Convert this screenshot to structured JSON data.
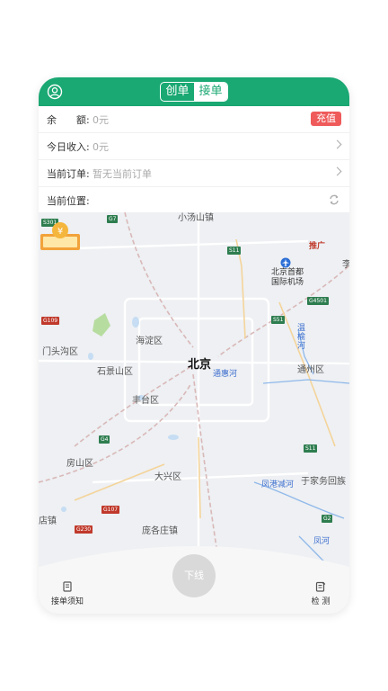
{
  "header": {
    "tabs": [
      {
        "label": "创单",
        "active": false
      },
      {
        "label": "接单",
        "active": true
      }
    ],
    "color": "#1aa873"
  },
  "info": {
    "rows": [
      {
        "label": "余　　额:",
        "value": "0元",
        "action": "充值"
      },
      {
        "label": "今日收入:",
        "value": "0元"
      },
      {
        "label": "当前订单:",
        "value": "暂无当前订单"
      },
      {
        "label": "当前位置:",
        "value": ""
      }
    ],
    "recharge_color": "#ef5a5a"
  },
  "map": {
    "city": "北京",
    "places": [
      "门头沟区",
      "海淀区",
      "石景山区",
      "丰台区",
      "房山区",
      "大兴区",
      "通州区",
      "庞各庄镇",
      "店镇",
      "于家务回族",
      "小汤山镇",
      "李"
    ],
    "airport": "北京首都国际机场",
    "rivers": [
      "通惠河",
      "温榆河",
      "凤港减河",
      "凤河"
    ],
    "shields": [
      "S301",
      "G7",
      "S11",
      "G4501",
      "S51",
      "G109",
      "G4",
      "S11",
      "G107",
      "G230",
      "G2"
    ],
    "promo": "推广"
  },
  "bottom": {
    "offline_label": "下线",
    "notice_label": "接单须知",
    "detect_label": "检 测"
  }
}
